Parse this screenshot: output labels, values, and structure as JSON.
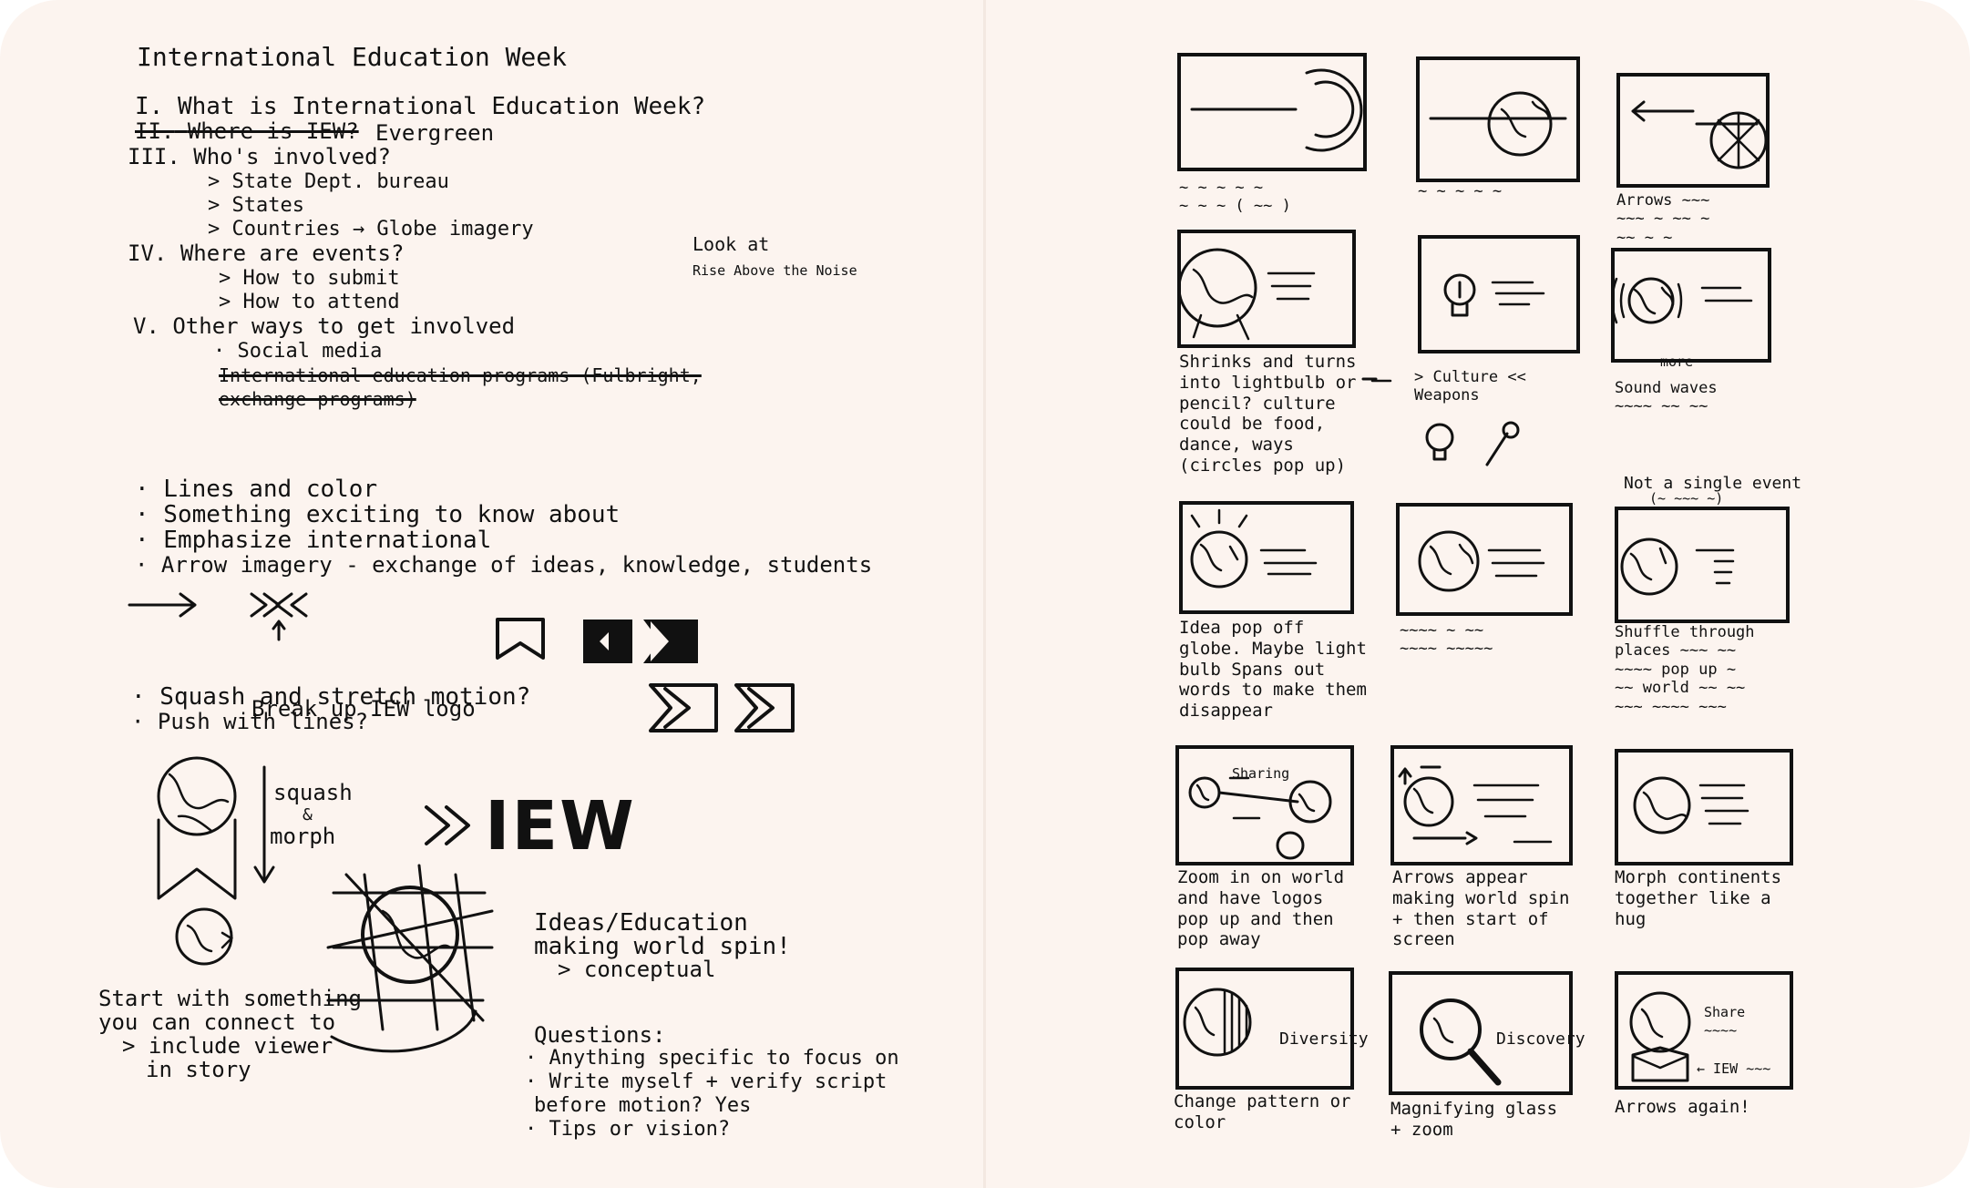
{
  "notes": {
    "title": "International Education Week",
    "outline": [
      {
        "numeral": "I.",
        "text": "What is International Education Week?"
      },
      {
        "numeral": "II.",
        "text": "Where is IEW?",
        "struck": true
      },
      {
        "numeral": "",
        "text": "Evergreen"
      },
      {
        "numeral": "III.",
        "text": "Who's involved?"
      },
      {
        "numeral": "",
        "text": "> State Dept. bureau"
      },
      {
        "numeral": "",
        "text": "> States"
      },
      {
        "numeral": "",
        "text": "> Countries → Globe imagery"
      },
      {
        "numeral": "IV.",
        "text": "Where are events?"
      },
      {
        "numeral": "",
        "text": "> How to submit"
      },
      {
        "numeral": "",
        "text": "> How to attend"
      },
      {
        "numeral": "V.",
        "text": "Other ways to get involved"
      },
      {
        "numeral": "",
        "text": "· Social media"
      },
      {
        "numeral": "",
        "text": "International education programs (Fulbright,",
        "struck": true
      },
      {
        "numeral": "",
        "text": "exchange programs)",
        "struck": true
      }
    ],
    "side_note": [
      "Look at",
      "Rise Above the Noise"
    ],
    "bullets": [
      "· Lines and color",
      "· Something exciting to know about",
      "· Emphasize international",
      "· Arrow imagery - exchange of ideas, knowledge, students"
    ],
    "logo_note": "Break up IEW logo",
    "motion_bullets": [
      "· Squash and stretch motion?",
      "· Push with lines?"
    ],
    "squash_label": [
      "squash",
      "&",
      "morph"
    ],
    "iew_logo_text": "IEW",
    "start_note": [
      "Start with something",
      "you can connect to",
      "> include viewer",
      "in story"
    ],
    "ideas_note": [
      "Ideas/Education",
      "making world spin!",
      "> conceptual"
    ],
    "questions_title": "Questions:",
    "questions": [
      "· Anything specific to focus on",
      "· Write myself + verify script",
      "before motion? Yes",
      "· Tips or vision?"
    ]
  },
  "storyboard": {
    "panels": [
      {
        "caption": "",
        "scribble": [
          "~ ~ ~ ~ ~",
          "~ ~ ~ ( ~~ )"
        ]
      },
      {
        "caption": "",
        "scribble": [
          "~ ~ ~ ~ ~"
        ]
      },
      {
        "caption": "",
        "scribble": [
          "Arrows ~~~",
          "~~~ ~ ~~ ~",
          "~~ ~ ~"
        ]
      },
      {
        "caption": "Shrinks and turns into lightbulb or pencil? culture could be food, dance, ways (circles pop up)",
        "scribble": []
      },
      {
        "caption": "",
        "scribble": [
          "> Culture <<",
          "Weapons"
        ]
      },
      {
        "caption": "",
        "scribble": [
          "Sound waves",
          "~~~~ ~~ ~~"
        ]
      },
      {
        "caption": "Idea pop off globe. Maybe light bulb Spans out words to make them disappear",
        "scribble": []
      },
      {
        "caption": "",
        "scribble": [
          "~~~~ ~ ~~",
          "~~~~ ~~~~~"
        ]
      },
      {
        "caption": "",
        "scribble": [
          "Shuffle through",
          "places ~~~ ~~",
          "~~~~ pop up ~",
          "~~ world ~~ ~~",
          "~~~ ~~~~ ~~~"
        ]
      },
      {
        "caption": "Zoom in on world and have logos pop up and then pop away",
        "scribble": []
      },
      {
        "caption": "Arrows appear making world spin + then start of screen",
        "scribble": []
      },
      {
        "caption": "Morph continents together like a hug",
        "scribble": []
      },
      {
        "caption": "Change pattern or color",
        "scribble": []
      },
      {
        "caption": "Magnifying glass + zoom",
        "scribble": []
      },
      {
        "caption": "Arrows again!",
        "scribble": []
      }
    ],
    "panel_labels": {
      "p5_right": "more",
      "p10_top": "Sharing",
      "p13": "Diversity",
      "p14": "Discovery",
      "p15a": "Share",
      "p15b": "~~~~",
      "p15c": "← IEW ~~~",
      "not_single_event": "Not a single event",
      "not_single_event_sub": "(~ ~~~ ~)"
    }
  }
}
